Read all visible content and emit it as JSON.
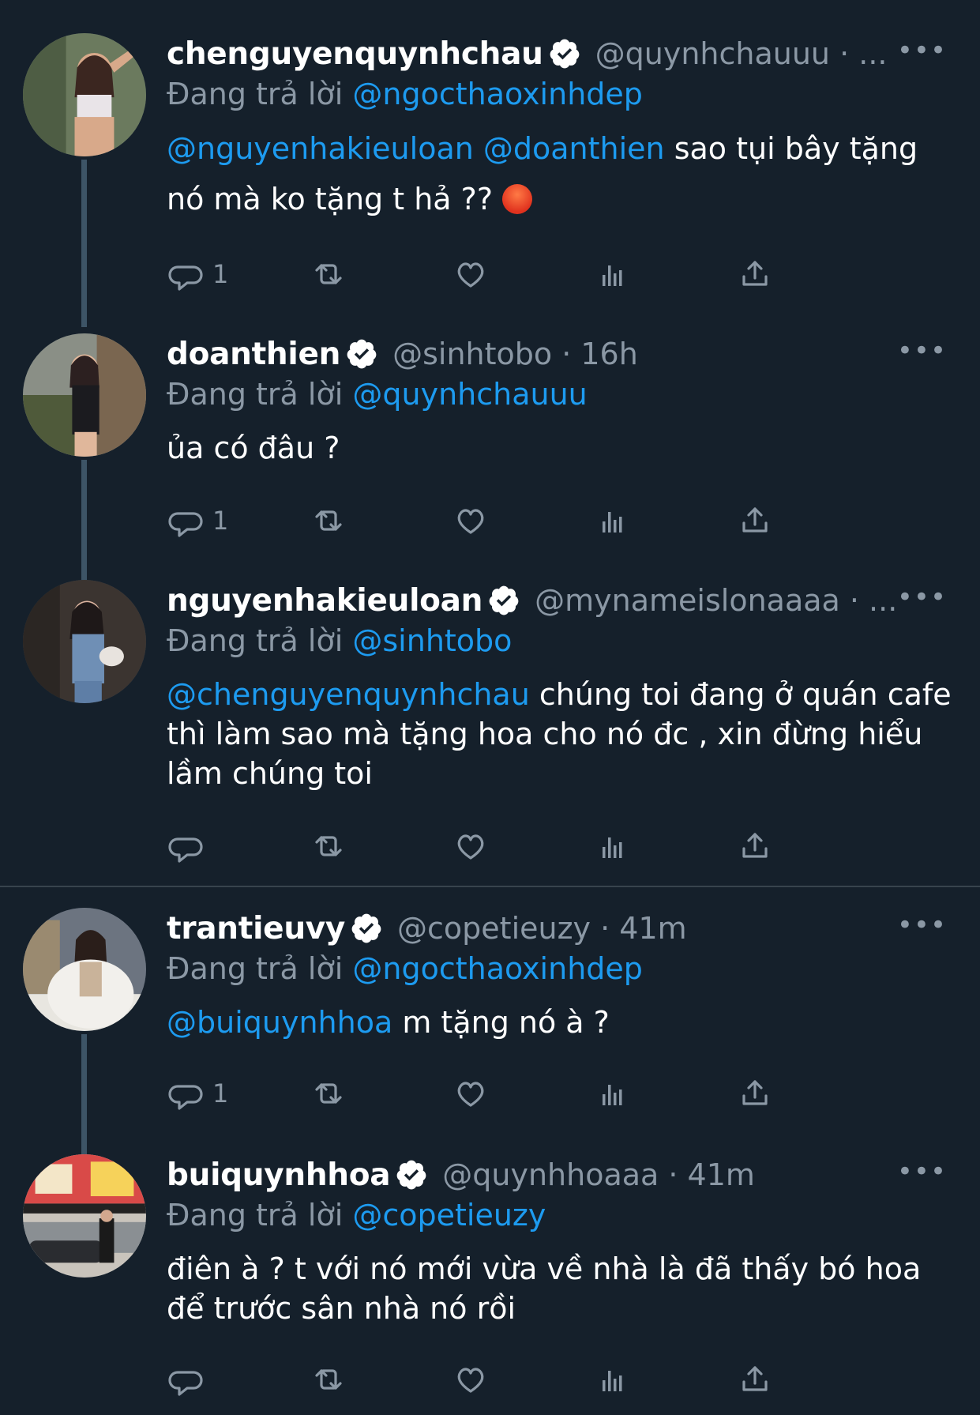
{
  "colors": {
    "background": "#15202b",
    "mention": "#1d9bf0",
    "secondary": "#8b98a5",
    "divider": "#38444d"
  },
  "reply_prefix": "Đang trả lời",
  "more_icon": "more-horizontal-icon",
  "tweets": [
    {
      "name": "chenguyenquynhchau",
      "handle_time": "@quynhchauuu · ...",
      "replying_to": "@ngocthaoxinhdep",
      "text_mentions": "@nguyenhakieuloan @doanthien",
      "text_1": " sao tụi bây tặng",
      "text_2": "nó mà ko tặng t hả ?? ",
      "emoji": "angry-face-emoji",
      "reply_count": "1"
    },
    {
      "name": "doanthien",
      "handle_time": "@sinhtobo · 16h",
      "replying_to": "@quynhchauuu",
      "text_1": "ủa có đâu ?",
      "reply_count": "1"
    },
    {
      "name": "nguyenhakieuloan",
      "handle_time": "@mynameislonaaaa · ...",
      "replying_to": "@sinhtobo",
      "text_mentions": "@chenguyenquynhchau",
      "text_1": " chúng toi đang ở quán cafe thì làm sao mà tặng hoa cho nó đc , xin đừng hiểu lầm chúng toi",
      "reply_count": ""
    },
    {
      "name": "trantieuvy",
      "handle_time": "@copetieuzy · 41m",
      "replying_to": "@ngocthaoxinhdep",
      "text_mentions": "@buiquynhhoa",
      "text_1": " m tặng nó à ?",
      "reply_count": "1"
    },
    {
      "name": "buiquynhhoa",
      "handle_time": "@quynhhoaaa · 41m",
      "replying_to": "@copetieuzy",
      "text_1": "điên à ? t với nó mới vừa về nhà là đã thấy bó hoa để trước sân nhà nó rồi",
      "reply_count": ""
    }
  ]
}
